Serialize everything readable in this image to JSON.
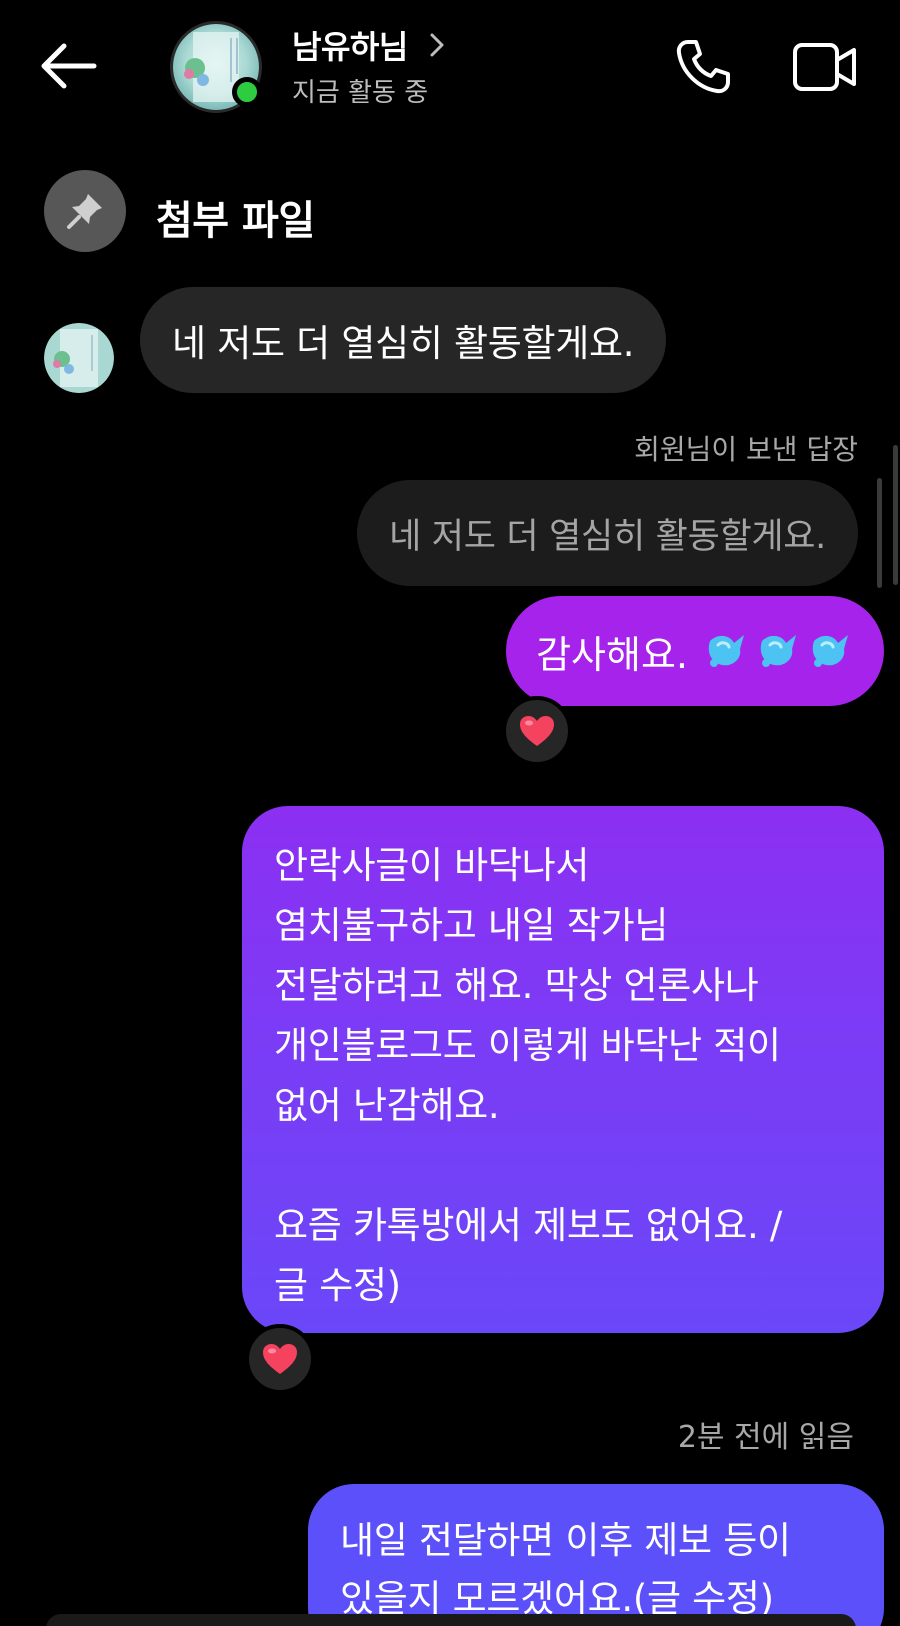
{
  "header": {
    "contact_name": "남유하님",
    "status": "지금 활동 중"
  },
  "pinned": {
    "label": "첨부 파일"
  },
  "messages": {
    "incoming_text": "네 저도 더 열심히 활동할게요.",
    "reply_label": "회원님이 보낸 답장",
    "reply_quote": "네 저도 더 열심히 활동할게요.",
    "thanks_text": "감사해요.",
    "long_lines": [
      "안락사글이 바닥나서",
      "염치불구하고 내일 작가님",
      "전달하려고 해요. 막상 언론사나",
      "개인블로그도 이렇게 바닥난 적이",
      "없어 난감해요.",
      "",
      "요즘 카톡방에서 제보도 없어요. /",
      "글 수정)"
    ],
    "read_receipt": "2분 전에 읽음",
    "last_lines": [
      "내일 전달하면 이후 제보 등이",
      "있을지 모르겠어요.(글 수정)"
    ],
    "reaction": "heart"
  },
  "colors": {
    "background": "#000000",
    "incoming_bubble": "#262626",
    "thanks_bubble": "#a523ea",
    "long_bubble_top": "#8c2ff2",
    "long_bubble_bottom": "#6a47f8",
    "last_bubble": "#5c50fa",
    "online_dot": "#2ecc40"
  },
  "icons": {
    "back": "back-arrow-icon",
    "call": "phone-icon",
    "video": "video-camera-icon",
    "pin": "pin-icon",
    "drops": "sweat-droplets-icon",
    "reaction": "heart-icon"
  }
}
